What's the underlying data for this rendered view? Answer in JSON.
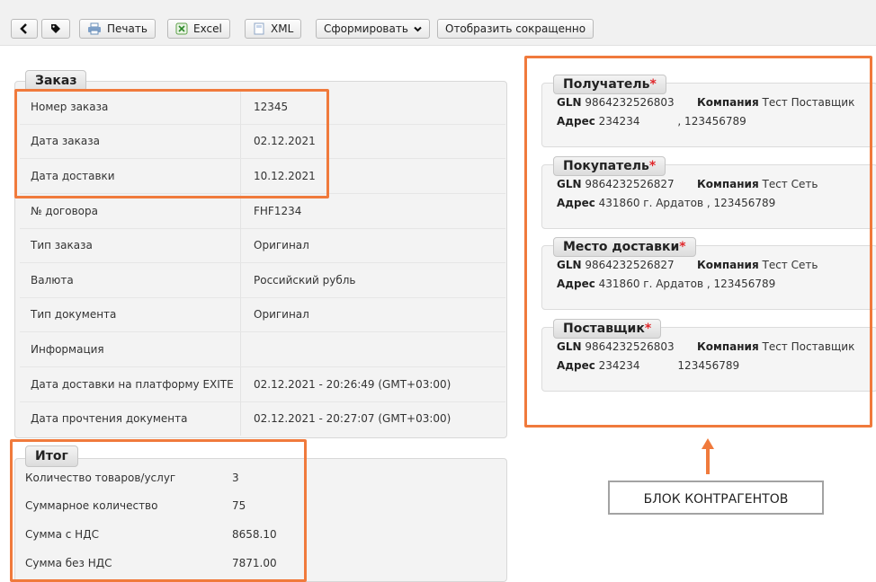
{
  "toolbar": {
    "print_label": "Печать",
    "excel_label": "Excel",
    "xml_label": "XML",
    "form_label": "Сформировать",
    "short_label": "Отобразить сокращенно"
  },
  "order": {
    "title": "Заказ",
    "rows": [
      {
        "key": "Номер заказа",
        "value": "12345"
      },
      {
        "key": "Дата заказа",
        "value": "02.12.2021"
      },
      {
        "key": "Дата доставки",
        "value": "10.12.2021"
      },
      {
        "key": "№ договора",
        "value": "FHF1234"
      },
      {
        "key": "Тип заказа",
        "value": "Оригинал"
      },
      {
        "key": "Валюта",
        "value": "Российский рубль"
      },
      {
        "key": "Тип документа",
        "value": "Оригинал"
      },
      {
        "key": "Информация",
        "value": ""
      },
      {
        "key": "Дата доставки на платформу EXITE",
        "value": "02.12.2021 - 20:26:49 (GMT+03:00)"
      },
      {
        "key": "Дата прочтения документа",
        "value": "02.12.2021 - 20:27:07 (GMT+03:00)"
      }
    ]
  },
  "total": {
    "title": "Итог",
    "rows": [
      {
        "key": "Количество товаров/услуг",
        "value": "3"
      },
      {
        "key": "Суммарное количество",
        "value": "75"
      },
      {
        "key": "Сумма с НДС",
        "value": "8658.10"
      },
      {
        "key": "Сумма без НДС",
        "value": "7871.00"
      }
    ]
  },
  "counterparties": {
    "gln_label": "GLN",
    "company_label": "Компания",
    "address_label": "Адрес",
    "required_mark": "*",
    "items": [
      {
        "title": "Получатель",
        "gln": "9864232526803",
        "company": "Тест Поставщик",
        "address": "234234           , 123456789"
      },
      {
        "title": "Покупатель",
        "gln": "9864232526827",
        "company": "Тест Сеть",
        "address": "431860 г. Ардатов , 123456789"
      },
      {
        "title": "Место доставки",
        "gln": "9864232526827",
        "company": "Тест Сеть",
        "address": "431860 г. Ардатов , 123456789"
      },
      {
        "title": "Поставщик",
        "gln": "9864232526803",
        "company": "Тест Поставщик",
        "address": "234234           123456789"
      }
    ]
  },
  "annotation": {
    "label": "БЛОК КОНТРАГЕНТОВ",
    "color": "#f07a3c"
  }
}
